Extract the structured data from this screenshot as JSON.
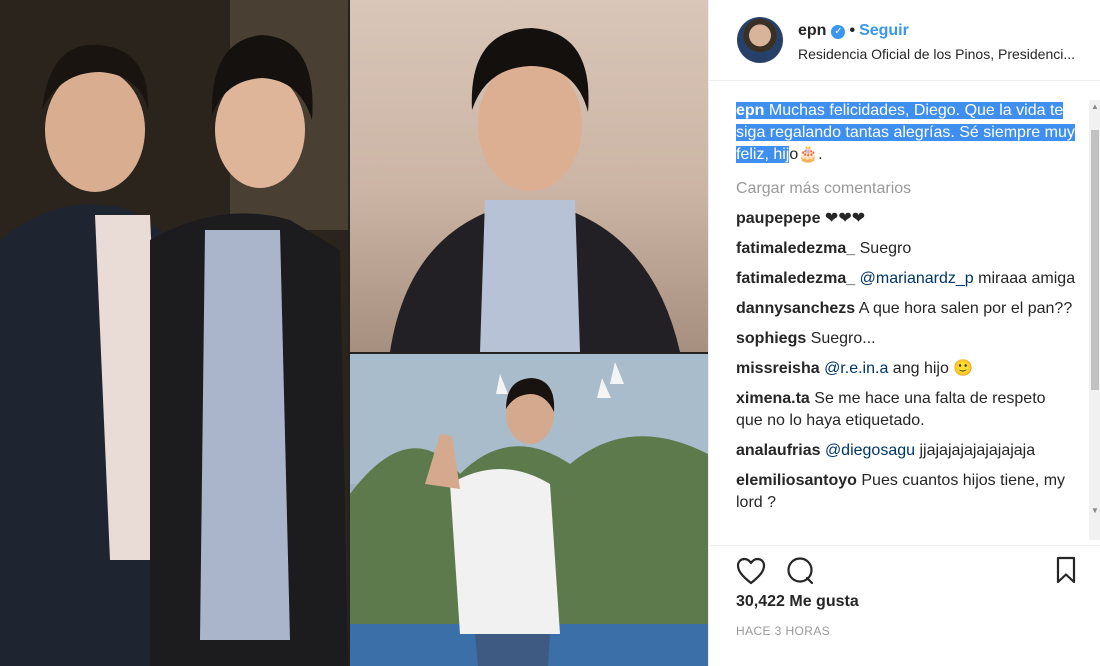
{
  "post": {
    "username": "epn",
    "verified_icon": "verified-badge-icon",
    "separator": "•",
    "follow_label": "Seguir",
    "location": "Residencia Oficial de los Pinos, Presidenci...",
    "caption_user": "epn",
    "caption_text_selected": "Muchas felicidades, Diego. Que la vida te siga regalando tantas alegrías. Sé siempre muy feliz, hij",
    "caption_text_rest": "o🎂.",
    "load_more": "Cargar más comentarios",
    "likes": "30,422 Me gusta",
    "time": "HACE 3 HORAS"
  },
  "comments": [
    {
      "user": "paupepepe",
      "text": "❤❤❤"
    },
    {
      "user": "fatimaledezma_",
      "text": "Suegro"
    },
    {
      "user": "fatimaledezma_",
      "mention": "@marianardz_p",
      "text": "miraaa amiga"
    },
    {
      "user": "dannysanchezs",
      "text": "A que hora salen por el pan??"
    },
    {
      "user": "sophiegs",
      "text": "Suegro..."
    },
    {
      "user": "missreisha",
      "mention": "@r.e.in.a",
      "text": "ang hijo 🙂"
    },
    {
      "user": "ximena.ta",
      "text": "Se me hace una falta de respeto que no lo haya etiquetado."
    },
    {
      "user": "analaufrias",
      "mention": "@diegosagu",
      "text": "jjajajajajajajajaja"
    },
    {
      "user": "elemiliosantoyo",
      "text": "Pues cuantos hijos tiene, my lord ?"
    }
  ],
  "colors": {
    "accent": "#3897f0",
    "selection": "#3f8ff0",
    "text": "#262626",
    "muted": "#999999"
  }
}
